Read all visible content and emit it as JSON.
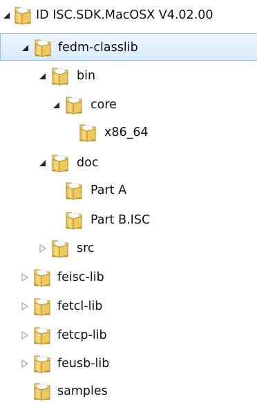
{
  "tree": {
    "selected_color": "#d8ebfb",
    "folder_icon": "folder-icon",
    "nodes": [
      {
        "label": "ID ISC.SDK.MacOSX V4.02.00",
        "state": "expanded",
        "selected": false
      },
      {
        "label": "fedm-classlib",
        "state": "expanded",
        "selected": true
      },
      {
        "label": "bin",
        "state": "expanded",
        "selected": false
      },
      {
        "label": "core",
        "state": "expanded",
        "selected": false
      },
      {
        "label": "x86_64",
        "state": "leaf",
        "selected": false
      },
      {
        "label": "doc",
        "state": "expanded",
        "selected": false
      },
      {
        "label": "Part A",
        "state": "leaf",
        "selected": false
      },
      {
        "label": "Part B.ISC",
        "state": "leaf",
        "selected": false
      },
      {
        "label": "src",
        "state": "collapsed",
        "selected": false
      },
      {
        "label": "feisc-lib",
        "state": "collapsed",
        "selected": false
      },
      {
        "label": "fetcl-lib",
        "state": "collapsed",
        "selected": false
      },
      {
        "label": "fetcp-lib",
        "state": "collapsed",
        "selected": false
      },
      {
        "label": "feusb-lib",
        "state": "collapsed",
        "selected": false
      },
      {
        "label": "samples",
        "state": "leaf",
        "selected": false
      }
    ]
  }
}
